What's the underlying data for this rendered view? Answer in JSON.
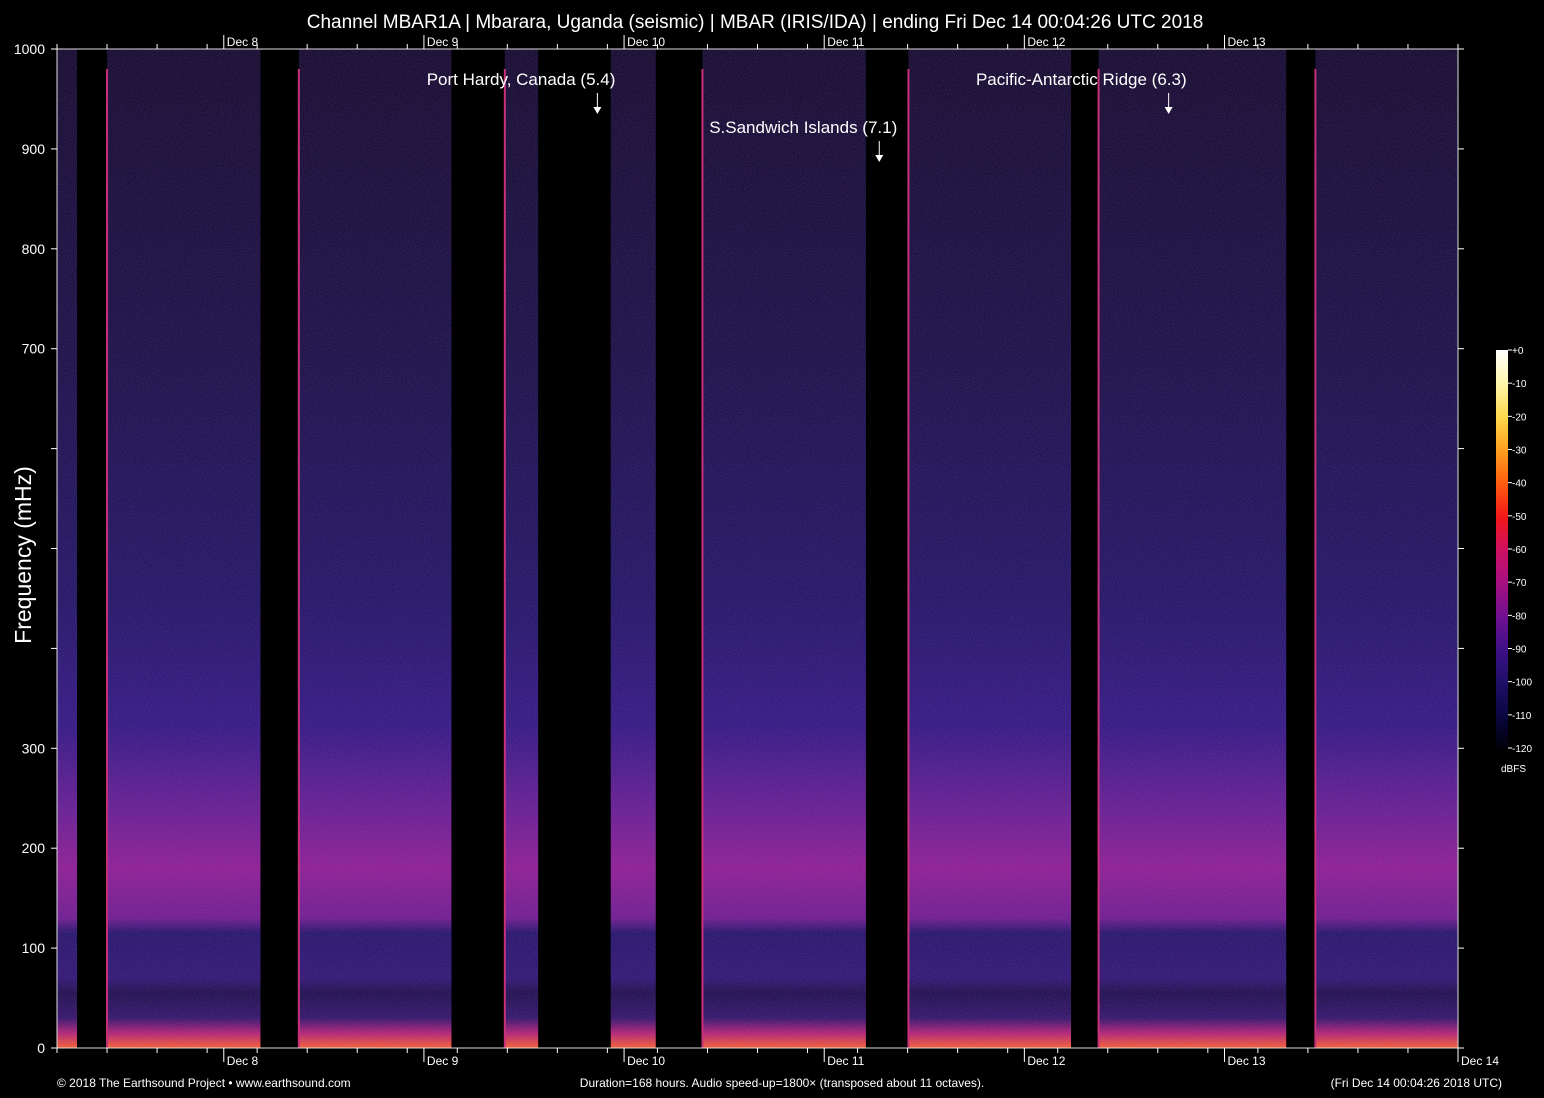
{
  "chart_data": {
    "type": "heatmap",
    "title": "Channel MBAR1A | Mbarara, Uganda (seismic) | MBAR (IRIS/IDA) | ending Fri Dec 14 00:04:26 UTC 2018",
    "ylabel": "Frequency (mHz)",
    "xlabel": "",
    "ylim": [
      0,
      1000
    ],
    "yticks": [
      0,
      100,
      200,
      300,
      400,
      500,
      600,
      700,
      800,
      900,
      1000
    ],
    "ytick_labels": [
      "0",
      "100",
      "200",
      "300",
      "",
      "",
      "",
      "700",
      "800",
      "900",
      "1000"
    ],
    "x_range_hours": [
      0,
      168
    ],
    "x_day_ticks": [
      {
        "label": "Dec  8",
        "hour": 20
      },
      {
        "label": "Dec  9",
        "hour": 44
      },
      {
        "label": "Dec 10",
        "hour": 68
      },
      {
        "label": "Dec 11",
        "hour": 92
      },
      {
        "label": "Dec 12",
        "hour": 116
      },
      {
        "label": "Dec 13",
        "hour": 140
      },
      {
        "label": "Dec 14",
        "hour": 168
      }
    ],
    "minor_tick_interval_hours": 6,
    "events": [
      {
        "label": "Port Hardy, Canada (5.4)",
        "hour": 64.8
      },
      {
        "label": "S.Sandwich Islands (7.1)",
        "hour": 98.6
      },
      {
        "label": "Pacific-Antarctic Ridge (6.3)",
        "hour": 133.3
      }
    ],
    "gaps_hours": [
      [
        2.4,
        6.0
      ],
      [
        24.4,
        29.0
      ],
      [
        47.3,
        53.7
      ],
      [
        57.7,
        66.4
      ],
      [
        71.8,
        77.4
      ],
      [
        97.0,
        102.1
      ],
      [
        121.6,
        124.9
      ],
      [
        147.4,
        150.9
      ]
    ],
    "spike_lines_hours": [
      6.0,
      29.0,
      53.7,
      77.4,
      102.1,
      124.9,
      150.9
    ],
    "colorbar": {
      "unit": "dBFS",
      "ticks": [
        "+0",
        "-10",
        "-20",
        "-30",
        "-40",
        "-50",
        "-60",
        "-70",
        "-80",
        "-90",
        "-100",
        "-110",
        "-120"
      ],
      "colors": [
        "#ffffff",
        "#fff7b0",
        "#ffd84a",
        "#ffa020",
        "#ff6010",
        "#f01818",
        "#d01060",
        "#a81080",
        "#701090",
        "#401088",
        "#20106a",
        "#0a0640",
        "#000008"
      ]
    },
    "grid": false
  },
  "footer": {
    "left": "© 2018 The Earthsound Project • www.earthsound.com",
    "center": "Duration=168 hours. Audio speed-up=1800× (transposed about 11 octaves).",
    "right": "(Fri Dec 14 00:04:26 2018 UTC)"
  }
}
